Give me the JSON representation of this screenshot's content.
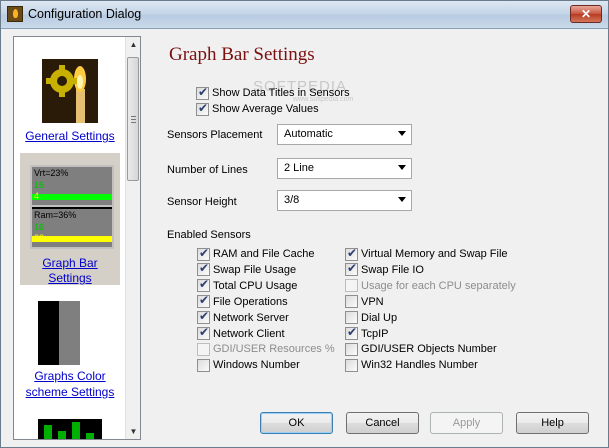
{
  "window": {
    "title": "Configuration Dialog",
    "close_label": "✕"
  },
  "sidebar": {
    "items": [
      {
        "label": "General Settings"
      },
      {
        "label_line1": "Graph Bar",
        "label_line2": "Settings",
        "preview": {
          "line1": "Vrt=23%",
          "line1_val": "16",
          "line2_val": "4",
          "line3": "Ram=36%",
          "line3_val": "16",
          "line4_val": "22"
        }
      },
      {
        "label_line1": "Graphs Color",
        "label_line2": "scheme Settings"
      }
    ]
  },
  "main": {
    "heading": "Graph Bar Settings",
    "watermark": "SOFTPEDIA",
    "watermark_sub": "www.softpedia.com",
    "top_checkboxes": [
      {
        "label": "Show Data Titles in Sensors",
        "checked": true
      },
      {
        "label": "Show Average Values",
        "checked": true
      }
    ],
    "fields": [
      {
        "label": "Sensors Placement",
        "value": "Automatic"
      },
      {
        "label": "Number of Lines",
        "value": "2 Line"
      },
      {
        "label": "Sensor Height",
        "value": "3/8"
      }
    ],
    "enabled_sensors_label": "Enabled Sensors",
    "sensors_left": [
      {
        "label": "RAM and  File Cache",
        "checked": true,
        "enabled": true
      },
      {
        "label": "Swap File Usage",
        "checked": true,
        "enabled": true
      },
      {
        "label": "Total CPU Usage",
        "checked": true,
        "enabled": true
      },
      {
        "label": "File Operations",
        "checked": true,
        "enabled": true
      },
      {
        "label": "Network Server",
        "checked": true,
        "enabled": true
      },
      {
        "label": "Network Client",
        "checked": true,
        "enabled": true
      },
      {
        "label": "GDI/USER Resources %",
        "checked": false,
        "enabled": false
      },
      {
        "label": "Windows Number",
        "checked": false,
        "enabled": true
      }
    ],
    "sensors_right": [
      {
        "label": "Virtual Memory and Swap File",
        "checked": true,
        "enabled": true
      },
      {
        "label": "Swap File IO",
        "checked": true,
        "enabled": true
      },
      {
        "label": "Usage for each CPU separately",
        "checked": false,
        "enabled": false
      },
      {
        "label": "VPN",
        "checked": false,
        "enabled": true
      },
      {
        "label": "Dial Up",
        "checked": false,
        "enabled": true
      },
      {
        "label": "TcpIP",
        "checked": true,
        "enabled": true
      },
      {
        "label": "GDI/USER Objects Number",
        "checked": false,
        "enabled": true
      },
      {
        "label": "Win32 Handles Number",
        "checked": false,
        "enabled": true
      }
    ]
  },
  "buttons": {
    "ok": "OK",
    "cancel": "Cancel",
    "apply": "Apply",
    "help": "Help"
  }
}
